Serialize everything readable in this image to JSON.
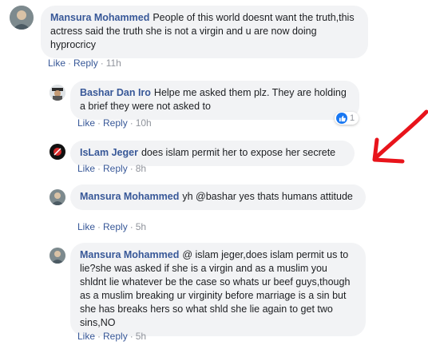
{
  "comments": [
    {
      "author": "Mansura Mohammed",
      "text": "People of this world doesnt want the truth,this actress said the truth she is not a virgin and u are now doing hyprocricy",
      "like_label": "Like",
      "reply_label": "Reply",
      "time": "11h"
    },
    {
      "author": "Bashar Dan Iro",
      "text": "Helpe me asked them plz. They are holding a brief they were not asked to",
      "like_label": "Like",
      "reply_label": "Reply",
      "time": "10h",
      "reaction_count": "1"
    },
    {
      "author": "IsLam Jeger",
      "text": "does islam permit her to expose her secrete",
      "like_label": "Like",
      "reply_label": "Reply",
      "time": "8h"
    },
    {
      "author": "Mansura Mohammed",
      "text": "yh @bashar yes thats humans attitude",
      "like_label": "Like",
      "reply_label": "Reply",
      "time": "5h"
    },
    {
      "author": "Mansura Mohammed",
      "text": "@ islam jeger,does islam permit us to lie?she was asked if she is a virgin and as a muslim you shldnt lie whatever be the case so whats ur beef guys,though as a muslim breaking ur virginity before marriage is a sin but she has breaks hers so what shld she lie again to get two sins,NO",
      "like_label": "Like",
      "reply_label": "Reply",
      "time": "5h"
    }
  ],
  "separator": "·",
  "colors": {
    "link": "#385898",
    "bubble": "#f2f3f5",
    "meta": "#90949c",
    "annotation_arrow": "#e8141b"
  }
}
